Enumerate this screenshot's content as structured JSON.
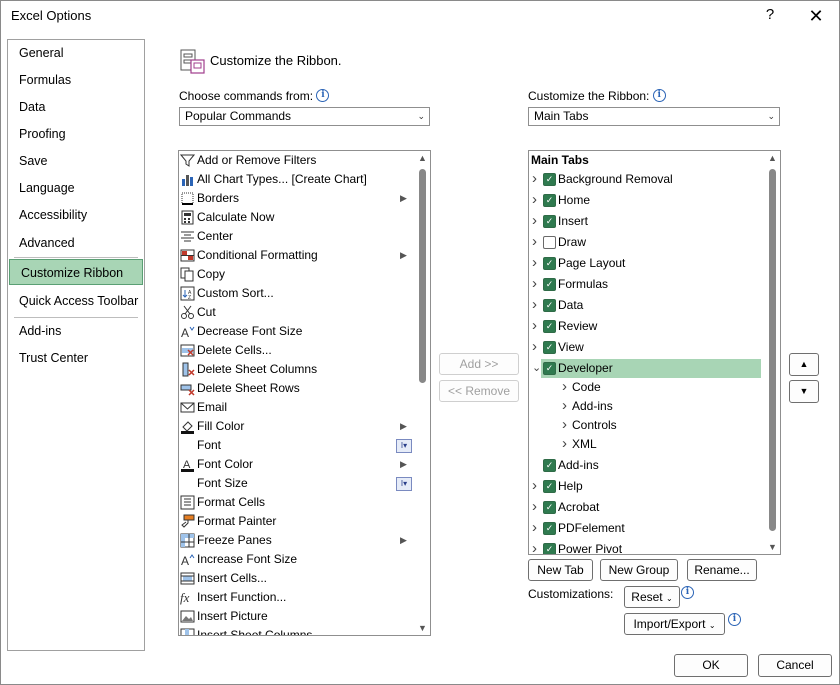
{
  "window": {
    "title": "Excel Options"
  },
  "nav": {
    "items": [
      "General",
      "Formulas",
      "Data",
      "Proofing",
      "Save",
      "Language",
      "Accessibility",
      "Advanced",
      "Customize Ribbon",
      "Quick Access Toolbar",
      "Add-ins",
      "Trust Center"
    ],
    "selected": "Customize Ribbon"
  },
  "header": {
    "title": "Customize the Ribbon."
  },
  "choose": {
    "label": "Choose commands from:",
    "value": "Popular Commands"
  },
  "customize": {
    "label": "Customize the Ribbon:",
    "value": "Main Tabs"
  },
  "commands": [
    {
      "label": "Add or Remove Filters",
      "icon": "filter-icon"
    },
    {
      "label": "All Chart Types... [Create Chart]",
      "icon": "chart-icon"
    },
    {
      "label": "Borders",
      "icon": "borders-icon",
      "submenu": true
    },
    {
      "label": "Calculate Now",
      "icon": "calculator-icon"
    },
    {
      "label": "Center",
      "icon": "center-align-icon"
    },
    {
      "label": "Conditional Formatting",
      "icon": "conditional-formatting-icon",
      "submenu": true
    },
    {
      "label": "Copy",
      "icon": "copy-icon"
    },
    {
      "label": "Custom Sort...",
      "icon": "sort-icon"
    },
    {
      "label": "Cut",
      "icon": "scissors-icon"
    },
    {
      "label": "Decrease Font Size",
      "icon": "decrease-font-icon"
    },
    {
      "label": "Delete Cells...",
      "icon": "delete-cells-icon"
    },
    {
      "label": "Delete Sheet Columns",
      "icon": "delete-columns-icon"
    },
    {
      "label": "Delete Sheet Rows",
      "icon": "delete-rows-icon"
    },
    {
      "label": "Email",
      "icon": "email-icon"
    },
    {
      "label": "Fill Color",
      "icon": "fill-color-icon",
      "submenu": true
    },
    {
      "label": "Font",
      "icon": "",
      "dropdown": true
    },
    {
      "label": "Font Color",
      "icon": "font-color-icon",
      "submenu": true
    },
    {
      "label": "Font Size",
      "icon": "",
      "dropdown": true
    },
    {
      "label": "Format Cells",
      "icon": "format-cells-icon"
    },
    {
      "label": "Format Painter",
      "icon": "format-painter-icon"
    },
    {
      "label": "Freeze Panes",
      "icon": "freeze-panes-icon",
      "submenu": true
    },
    {
      "label": "Increase Font Size",
      "icon": "increase-font-icon"
    },
    {
      "label": "Insert Cells...",
      "icon": "insert-cells-icon"
    },
    {
      "label": "Insert Function...",
      "icon": "function-icon"
    },
    {
      "label": "Insert Picture",
      "icon": "picture-icon"
    },
    {
      "label": "Insert Sheet Columns",
      "icon": "insert-columns-icon"
    }
  ],
  "tree": {
    "header": "Main Tabs",
    "items": [
      {
        "label": "Background Removal",
        "level": 0,
        "expand": "right",
        "checked": true
      },
      {
        "label": "Home",
        "level": 0,
        "expand": "right",
        "checked": true
      },
      {
        "label": "Insert",
        "level": 0,
        "expand": "right",
        "checked": true
      },
      {
        "label": "Draw",
        "level": 0,
        "expand": "right",
        "checked": false
      },
      {
        "label": "Page Layout",
        "level": 0,
        "expand": "right",
        "checked": true
      },
      {
        "label": "Formulas",
        "level": 0,
        "expand": "right",
        "checked": true
      },
      {
        "label": "Data",
        "level": 0,
        "expand": "right",
        "checked": true
      },
      {
        "label": "Review",
        "level": 0,
        "expand": "right",
        "checked": true
      },
      {
        "label": "View",
        "level": 0,
        "expand": "right",
        "checked": true
      },
      {
        "label": "Developer",
        "level": 0,
        "expand": "down",
        "checked": true,
        "selected": true
      },
      {
        "label": "Code",
        "level": 1,
        "expand": "right"
      },
      {
        "label": "Add-ins",
        "level": 1,
        "expand": "right"
      },
      {
        "label": "Controls",
        "level": 1,
        "expand": "right"
      },
      {
        "label": "XML",
        "level": 1,
        "expand": "right"
      },
      {
        "label": "Add-ins",
        "level": 0,
        "expand": "none",
        "checked": true
      },
      {
        "label": "Help",
        "level": 0,
        "expand": "right",
        "checked": true
      },
      {
        "label": "Acrobat",
        "level": 0,
        "expand": "right",
        "checked": true
      },
      {
        "label": "PDFelement",
        "level": 0,
        "expand": "right",
        "checked": true
      },
      {
        "label": "Power Pivot",
        "level": 0,
        "expand": "right",
        "checked": true
      }
    ]
  },
  "buttons": {
    "add": "Add >>",
    "remove": "<< Remove",
    "new_tab": "New Tab",
    "new_group": "New Group",
    "rename": "Rename...",
    "customizations_label": "Customizations:",
    "reset": "Reset",
    "import_export": "Import/Export",
    "ok": "OK",
    "cancel": "Cancel"
  },
  "colors": {
    "selection": "#a8d5b5",
    "check": "#2f7a4f",
    "info": "#2b64b6"
  }
}
